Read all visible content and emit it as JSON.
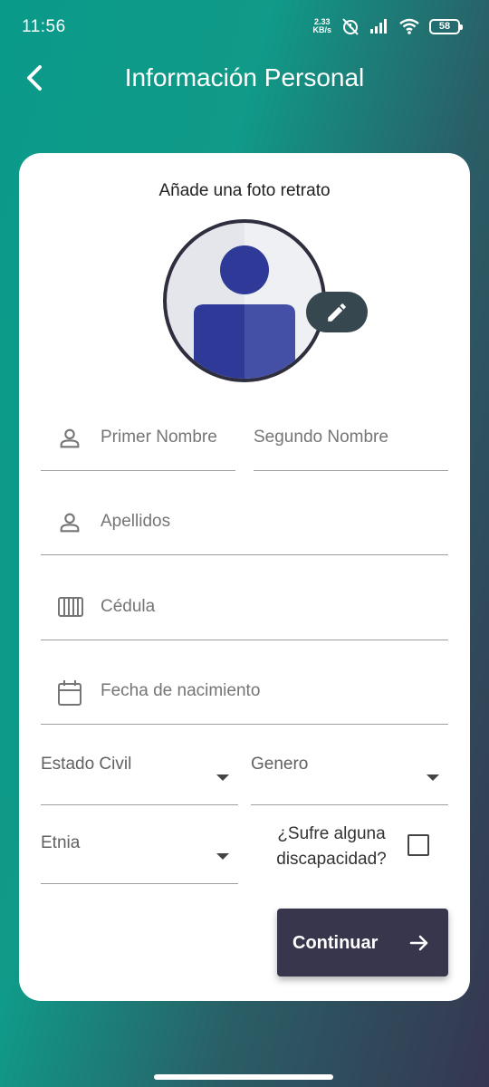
{
  "status_bar": {
    "time": "11:56",
    "speed_value": "2.33",
    "speed_unit": "KB/s",
    "battery": "58"
  },
  "header": {
    "title": "Información Personal"
  },
  "photo": {
    "label": "Añade una foto retrato"
  },
  "form": {
    "first_name_placeholder": "Primer Nombre",
    "second_name_placeholder": "Segundo Nombre",
    "last_names_placeholder": "Apellidos",
    "id_placeholder": "Cédula",
    "birthdate_placeholder": "Fecha de nacimiento",
    "marital_status_label": "Estado Civil",
    "gender_label": "Genero",
    "ethnicity_label": "Etnia",
    "disability_label": "¿Sufre alguna discapacidad?",
    "disability_checked": false
  },
  "actions": {
    "continue_label": "Continuar"
  },
  "colors": {
    "gradient_start": "#0a9a8a",
    "gradient_end": "#363650",
    "button_bg": "#37364d",
    "avatar_accent": "#3b44a0"
  },
  "icons": {
    "back": "chevron-left-icon",
    "edit": "pencil-icon",
    "person": "person-icon",
    "id": "barcode-icon",
    "calendar": "calendar-icon",
    "dropdown": "triangle-down-icon",
    "continue": "arrow-right-icon"
  }
}
